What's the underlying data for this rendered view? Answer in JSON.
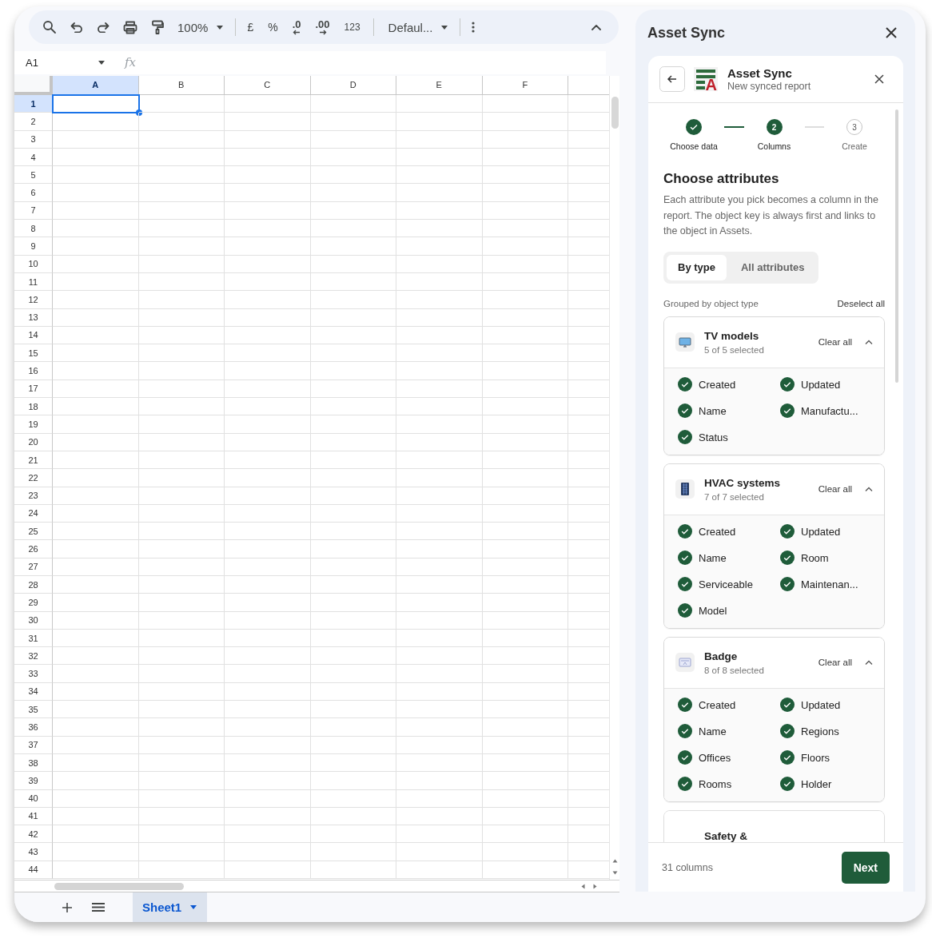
{
  "toolbar": {
    "zoom": "100%",
    "currency": "£",
    "percent": "%",
    "decrease_decimal": ".0",
    "increase_decimal": ".00",
    "number_format": "123",
    "font": "Defaul..."
  },
  "formula_bar": {
    "name_box": "A1",
    "fx_label": "fx"
  },
  "grid": {
    "columns": [
      {
        "label": "A",
        "selected": true
      },
      {
        "label": "B",
        "selected": false
      },
      {
        "label": "C",
        "selected": false
      },
      {
        "label": "D",
        "selected": false
      },
      {
        "label": "E",
        "selected": false
      },
      {
        "label": "F",
        "selected": false
      }
    ],
    "rows": [
      {
        "label": "1",
        "selected": true
      },
      {
        "label": "2",
        "selected": false
      },
      {
        "label": "3",
        "selected": false
      },
      {
        "label": "4",
        "selected": false
      },
      {
        "label": "5",
        "selected": false
      },
      {
        "label": "6",
        "selected": false
      },
      {
        "label": "7",
        "selected": false
      },
      {
        "label": "8",
        "selected": false
      },
      {
        "label": "9",
        "selected": false
      },
      {
        "label": "10",
        "selected": false
      },
      {
        "label": "11",
        "selected": false
      },
      {
        "label": "12",
        "selected": false
      },
      {
        "label": "13",
        "selected": false
      },
      {
        "label": "14",
        "selected": false
      },
      {
        "label": "15",
        "selected": false
      },
      {
        "label": "16",
        "selected": false
      },
      {
        "label": "17",
        "selected": false
      },
      {
        "label": "18",
        "selected": false
      },
      {
        "label": "19",
        "selected": false
      },
      {
        "label": "20",
        "selected": false
      },
      {
        "label": "21",
        "selected": false
      },
      {
        "label": "22",
        "selected": false
      },
      {
        "label": "23",
        "selected": false
      },
      {
        "label": "24",
        "selected": false
      },
      {
        "label": "25",
        "selected": false
      },
      {
        "label": "26",
        "selected": false
      },
      {
        "label": "27",
        "selected": false
      },
      {
        "label": "28",
        "selected": false
      },
      {
        "label": "29",
        "selected": false
      },
      {
        "label": "30",
        "selected": false
      },
      {
        "label": "31",
        "selected": false
      },
      {
        "label": "32",
        "selected": false
      },
      {
        "label": "33",
        "selected": false
      },
      {
        "label": "34",
        "selected": false
      },
      {
        "label": "35",
        "selected": false
      },
      {
        "label": "36",
        "selected": false
      },
      {
        "label": "37",
        "selected": false
      },
      {
        "label": "38",
        "selected": false
      },
      {
        "label": "39",
        "selected": false
      },
      {
        "label": "40",
        "selected": false
      },
      {
        "label": "41",
        "selected": false
      },
      {
        "label": "42",
        "selected": false
      },
      {
        "label": "43",
        "selected": false
      },
      {
        "label": "44",
        "selected": false
      }
    ]
  },
  "sheet_tabs": [
    {
      "label": "Sheet1",
      "selected": true
    }
  ],
  "sidebar": {
    "title": "Asset Sync",
    "card": {
      "logo_letter": "A",
      "title": "Asset Sync",
      "subtitle": "New synced report",
      "steps": [
        {
          "label": "Choose data",
          "completed": true,
          "selected": false
        },
        {
          "number": "2",
          "label": "Columns",
          "completed": false,
          "selected": true
        },
        {
          "number": "3",
          "label": "Create",
          "completed": false,
          "selected": false
        }
      ],
      "heading": "Choose attributes",
      "description": "Each attribute you pick becomes a column in the report. The object key is always first and links to the object in Assets.",
      "view_tabs": [
        {
          "label": "By type",
          "selected": true
        },
        {
          "label": "All attributes",
          "selected": false
        }
      ],
      "group_caption": "Grouped by object type",
      "deselect_all": "Deselect all",
      "groups": [
        {
          "name": "TV models",
          "count": "5 of 5 selected",
          "clear": "Clear all",
          "expanded": true,
          "attributes": [
            {
              "label": "Created",
              "checked": true
            },
            {
              "label": "Updated",
              "checked": true
            },
            {
              "label": "Name",
              "checked": true
            },
            {
              "label": "Manufactu...",
              "checked": true
            },
            {
              "label": "Status",
              "checked": true
            }
          ]
        },
        {
          "name": "HVAC systems",
          "count": "7 of 7 selected",
          "clear": "Clear all",
          "expanded": true,
          "attributes": [
            {
              "label": "Created",
              "checked": true
            },
            {
              "label": "Updated",
              "checked": true
            },
            {
              "label": "Name",
              "checked": true
            },
            {
              "label": "Room",
              "checked": true
            },
            {
              "label": "Serviceable",
              "checked": true
            },
            {
              "label": "Maintenan...",
              "checked": true
            },
            {
              "label": "Model",
              "checked": true
            }
          ]
        },
        {
          "name": "Badge",
          "count": "8 of 8 selected",
          "clear": "Clear all",
          "expanded": true,
          "attributes": [
            {
              "label": "Created",
              "checked": true
            },
            {
              "label": "Updated",
              "checked": true
            },
            {
              "label": "Name",
              "checked": true
            },
            {
              "label": "Regions",
              "checked": true
            },
            {
              "label": "Offices",
              "checked": true
            },
            {
              "label": "Floors",
              "checked": true
            },
            {
              "label": "Rooms",
              "checked": true
            },
            {
              "label": "Holder",
              "checked": true
            }
          ]
        },
        {
          "name": "Safety &"
        }
      ],
      "footer_count": "31 columns",
      "next": "Next"
    }
  }
}
